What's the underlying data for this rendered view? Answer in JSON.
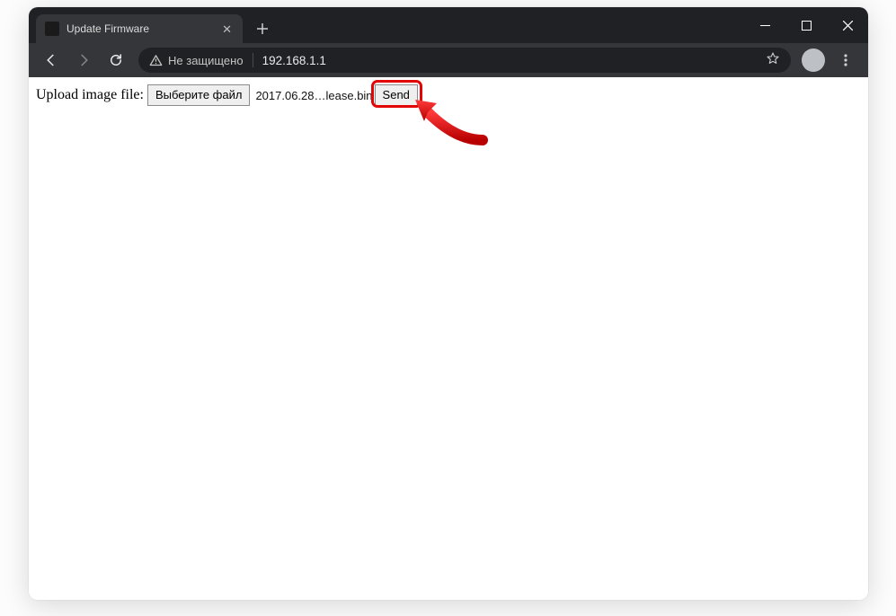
{
  "window": {
    "tab_title": "Update Firmware",
    "not_secure_label": "Не защищено",
    "url": "192.168.1.1"
  },
  "page": {
    "label": "Upload image file:",
    "choose_file_label": "Выберите файл",
    "selected_file": "2017.06.28…lease.bin",
    "send_label": "Send"
  }
}
